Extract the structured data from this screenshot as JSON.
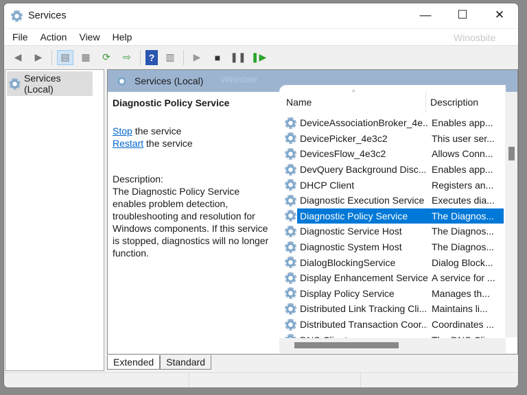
{
  "window": {
    "title": "Services",
    "minimize": "—",
    "maximize": "☐",
    "close": "✕"
  },
  "menu": [
    "File",
    "Action",
    "View",
    "Help"
  ],
  "watermark": "Winosbite",
  "tree": {
    "root": "Services (Local)"
  },
  "panel": {
    "title": "Services (Local)",
    "service_name": "Diagnostic Policy Service",
    "stop_link": "Stop",
    "stop_rest": " the service",
    "restart_link": "Restart",
    "restart_rest": " the service",
    "description_label": "Description:",
    "description": "The Diagnostic Policy Service enables problem detection, troubleshooting and resolution for Windows components.  If this service is stopped, diagnostics will no longer function."
  },
  "columns": {
    "name": "Name",
    "description": "Description"
  },
  "rows": [
    {
      "name": "DeviceAssociationBroker_4e...",
      "description": "Enables app..."
    },
    {
      "name": "DevicePicker_4e3c2",
      "description": "This user ser..."
    },
    {
      "name": "DevicesFlow_4e3c2",
      "description": "Allows Conn..."
    },
    {
      "name": "DevQuery Background Disc...",
      "description": "Enables app..."
    },
    {
      "name": "DHCP Client",
      "description": "Registers an..."
    },
    {
      "name": "Diagnostic Execution Service",
      "description": "Executes dia..."
    },
    {
      "name": "Diagnostic Policy Service",
      "description": "The Diagnos...",
      "selected": true
    },
    {
      "name": "Diagnostic Service Host",
      "description": "The Diagnos..."
    },
    {
      "name": "Diagnostic System Host",
      "description": "The Diagnos..."
    },
    {
      "name": "DialogBlockingService",
      "description": "Dialog Block..."
    },
    {
      "name": "Display Enhancement Service",
      "description": "A service for ..."
    },
    {
      "name": "Display Policy Service",
      "description": "Manages th..."
    },
    {
      "name": "Distributed Link Tracking Cli...",
      "description": "Maintains li..."
    },
    {
      "name": "Distributed Transaction Coor...",
      "description": "Coordinates ..."
    },
    {
      "name": "DNS Client",
      "description": "The DNS Cli..."
    }
  ],
  "tabs": [
    "Extended",
    "Standard"
  ]
}
